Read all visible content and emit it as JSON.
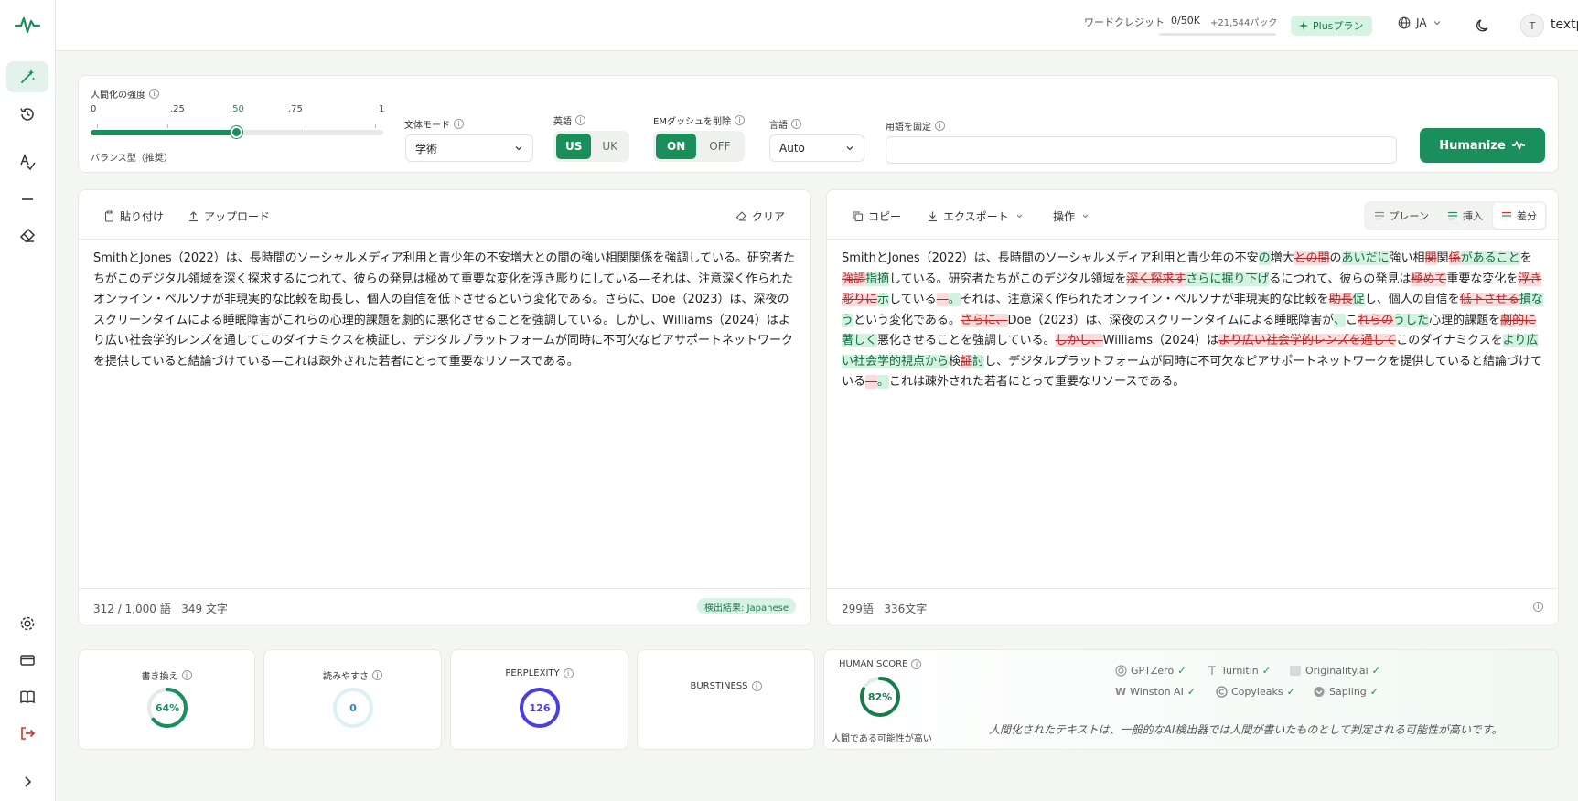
{
  "topbar": {
    "credit_label": "ワードクレジット",
    "credit_value": "0/50K",
    "credit_pack": "+21,544パック",
    "plan": "Plusプラン",
    "language": "JA",
    "avatar_initial": "T",
    "username": "textpulse"
  },
  "settings": {
    "intensity_label": "人間化の強度",
    "ticks": [
      "0",
      ".25",
      ".50",
      ".75",
      "1"
    ],
    "intensity_value": 0.5,
    "intensity_preset": "バランス型（推奨）",
    "style_label": "文体モード",
    "style_value": "学術",
    "english_label": "英語",
    "english_options": [
      "US",
      "UK"
    ],
    "english_selected": "US",
    "emdash_label": "EMダッシュを削除",
    "emdash_options": [
      "ON",
      "OFF"
    ],
    "emdash_selected": "ON",
    "language_label": "言語",
    "language_value": "Auto",
    "freeze_label": "用語を固定",
    "freeze_value": "",
    "humanize_label": "Humanize"
  },
  "input_panel": {
    "paste": "貼り付け",
    "upload": "アップロード",
    "clear": "クリア",
    "text": "SmithとJones（2022）は、長時間のソーシャルメディア利用と青少年の不安増大との間の強い相関関係を強調している。研究者たちがこのデジタル領域を深く探求するにつれて、彼らの発見は極めて重要な変化を浮き彫りにしている—それは、注意深く作られたオンライン・ペルソナが非現実的な比較を助長し、個人の自信を低下させるという変化である。さらに、Doe（2023）は、深夜のスクリーンタイムによる睡眠障害がこれらの心理的課題を劇的に悪化させることを強調している。しかし、Williams（2024）はより広い社会学的レンズを通してこのダイナミクスを検証し、デジタルプラットフォームが同時に不可欠なピアサポートネットワークを提供していると結論づけている—これは疎外された若者にとって重要なリソースである。",
    "word_count": "312 / 1,000 語",
    "char_count": "349 文字",
    "detected": "検出結果: Japanese"
  },
  "output_panel": {
    "copy": "コピー",
    "export": "エクスポート",
    "actions": "操作",
    "view_plain": "プレーン",
    "view_insert": "挿入",
    "view_diff": "差分",
    "segments": [
      {
        "t": "SmithとJones（2022）は、長時間のソーシャルメディア利用と青少年の不安",
        "k": "n"
      },
      {
        "t": "の",
        "k": "i"
      },
      {
        "t": "増大",
        "k": "n"
      },
      {
        "t": "との間",
        "k": "d"
      },
      {
        "t": "の",
        "k": "n"
      },
      {
        "t": "あいだに",
        "k": "i"
      },
      {
        "t": "強い相",
        "k": "n"
      },
      {
        "t": "関",
        "k": "d"
      },
      {
        "t": "関",
        "k": "n"
      },
      {
        "t": "係",
        "k": "d"
      },
      {
        "t": "が",
        "k": "i"
      },
      {
        "t": "あること",
        "k": "i"
      },
      {
        "t": "を",
        "k": "n"
      },
      {
        "t": "強調",
        "k": "d"
      },
      {
        "t": "指摘",
        "k": "i"
      },
      {
        "t": "している。研究者たちがこのデジタル領域を",
        "k": "n"
      },
      {
        "t": "深く探求す",
        "k": "d"
      },
      {
        "t": "さらに掘り下げ",
        "k": "i"
      },
      {
        "t": "るにつれて、彼らの発見は",
        "k": "n"
      },
      {
        "t": "極めて",
        "k": "d"
      },
      {
        "t": "重要な変化を",
        "k": "n"
      },
      {
        "t": "浮き彫りに",
        "k": "d"
      },
      {
        "t": "示",
        "k": "i"
      },
      {
        "t": "している",
        "k": "n"
      },
      {
        "t": "—",
        "k": "d"
      },
      {
        "t": "。",
        "k": "i"
      },
      {
        "t": "それは、注意深く作られたオンライン・ペルソナが非現実的な比較を",
        "k": "n"
      },
      {
        "t": "助長",
        "k": "d"
      },
      {
        "t": "促",
        "k": "i"
      },
      {
        "t": "し、個人の自信を",
        "k": "n"
      },
      {
        "t": "低下させる",
        "k": "d"
      },
      {
        "t": "損なう",
        "k": "i"
      },
      {
        "t": "という変化である。",
        "k": "n"
      },
      {
        "t": "さらに、",
        "k": "d"
      },
      {
        "t": "Doe（2023）は、深夜のスクリーンタイムによる睡眠障害が",
        "k": "n"
      },
      {
        "t": "、",
        "k": "i"
      },
      {
        "t": "こ",
        "k": "n"
      },
      {
        "t": "れらの",
        "k": "d"
      },
      {
        "t": "うした",
        "k": "i"
      },
      {
        "t": "心理的課題を",
        "k": "n"
      },
      {
        "t": "劇的に",
        "k": "d"
      },
      {
        "t": "著しく",
        "k": "i"
      },
      {
        "t": "悪化させることを強調している。",
        "k": "n"
      },
      {
        "t": "しかし、",
        "k": "d"
      },
      {
        "t": "Williams（2024）は",
        "k": "n"
      },
      {
        "t": "より広い社会学的レンズを通して",
        "k": "d"
      },
      {
        "t": "このダイナミクスを",
        "k": "n"
      },
      {
        "t": "より広い社会学的視点から",
        "k": "i"
      },
      {
        "t": "検",
        "k": "n"
      },
      {
        "t": "証",
        "k": "d"
      },
      {
        "t": "討",
        "k": "i"
      },
      {
        "t": "し、デジタルプラットフォームが同時に不可欠なピアサポートネットワークを提供していると結論づけている",
        "k": "n"
      },
      {
        "t": "—",
        "k": "d"
      },
      {
        "t": "。",
        "k": "i"
      },
      {
        "t": "これは疎外された若者にとって重要なリソースである。",
        "k": "n"
      }
    ],
    "word_count": "299語",
    "char_count": "336文字"
  },
  "metrics": {
    "rewrite_label": "書き換え",
    "rewrite_value": "64%",
    "rewrite_fraction": 0.64,
    "readability_label": "読みやすさ",
    "readability_value": "0",
    "readability_fraction": 0,
    "perplexity_label": "PERPLEXITY",
    "perplexity_value": "126",
    "perplexity_fraction": 1,
    "burstiness_label": "BURSTINESS"
  },
  "human": {
    "label": "HUMAN SCORE",
    "value": "82%",
    "fraction": 0.82,
    "caption": "人間である可能性が高い",
    "detectors": [
      "GPTZero",
      "Turnitin",
      "Originality.ai",
      "Winston AI",
      "Copyleaks",
      "Sapling"
    ],
    "note": "人間化されたテキストは、一般的なAI検出器では人間が書いたものとして判定される可能性が高いです。"
  },
  "colors": {
    "accent": "#1a8f5b",
    "insert_bg": "#d3f3e0",
    "delete_bg": "#fadcdc",
    "readability_ring": "#66c1d6",
    "perplexity_ring": "#4b3fe0",
    "logout_icon": "#d93025"
  }
}
